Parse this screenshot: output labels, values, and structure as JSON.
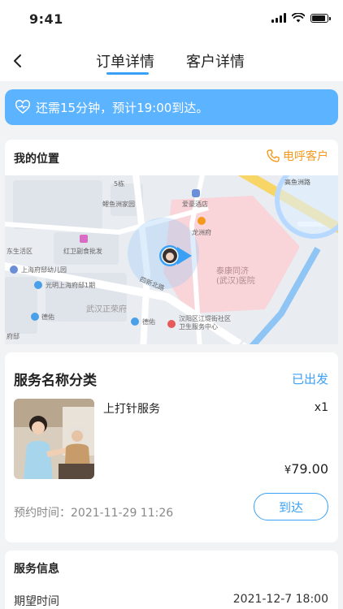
{
  "status_bar": {
    "time": "9:41"
  },
  "nav": {
    "tabs": [
      {
        "label": "订单详情",
        "active": true
      },
      {
        "label": "客户详情",
        "active": false
      }
    ]
  },
  "notice": {
    "text": "还需15分钟，预计19:00到达。"
  },
  "location": {
    "title": "我的位置",
    "call_label": "电呼客户",
    "map_labels": {
      "gaoyu": "高鱼洲路",
      "fish": "鲤鱼洲家园",
      "hotel": "爱豪酒店",
      "longzhou": "龙洲府",
      "east": "东生活区",
      "hongwei": "红卫副食批发",
      "kindergarten": "上海府邸幼儿园",
      "guangming": "光明上海府邸1期",
      "road": "四新北路",
      "hospital": "泰康同济\n(武汉)医院",
      "wuhan_zhengrong": "武汉正荣府",
      "deyou1": "德佑",
      "deyou2": "德佑",
      "health": "汉阳区江堤街社区\n卫生服务中心",
      "fudi": "府邸",
      "num5": "5栋"
    }
  },
  "service": {
    "title": "服务名称分类",
    "status": "已出发",
    "item_name": "上打针服务",
    "quantity": "x1",
    "price_symbol": "¥",
    "price": "79.00",
    "appointment": "预约时间：2021-11-29 11:26",
    "arrive_label": "到达"
  },
  "info": {
    "title": "服务信息",
    "expected_label": "期望时间",
    "expected_value": "2021-12-7 18:00"
  },
  "colors": {
    "accent": "#3aa0f5",
    "notice_bg": "#5cb3ff",
    "call": "#f39a1e"
  }
}
